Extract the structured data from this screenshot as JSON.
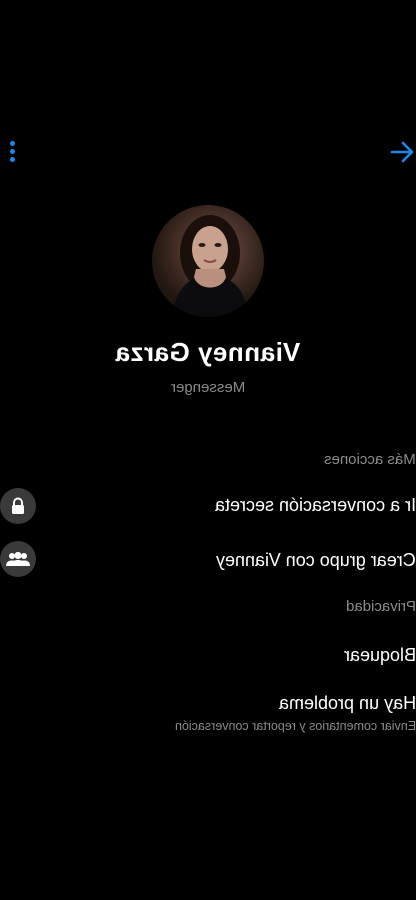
{
  "header": {
    "options_icon": "vertical-dots-icon",
    "back_icon": "arrow-icon",
    "accent": "#1e88e5"
  },
  "profile": {
    "name": "Vianney Garza",
    "subtitle": "Messenger"
  },
  "sections": {
    "more_actions": "Más acciones",
    "privacy": "Privacidad"
  },
  "actions": {
    "secret_conversation": "Ir a conversación secreta",
    "create_group": "Crear grupo con Vianney"
  },
  "privacy_items": {
    "block": "Bloquear",
    "report_title": "Hay un problema",
    "report_subtitle": "Enviar comentarios y reportar conversación"
  }
}
